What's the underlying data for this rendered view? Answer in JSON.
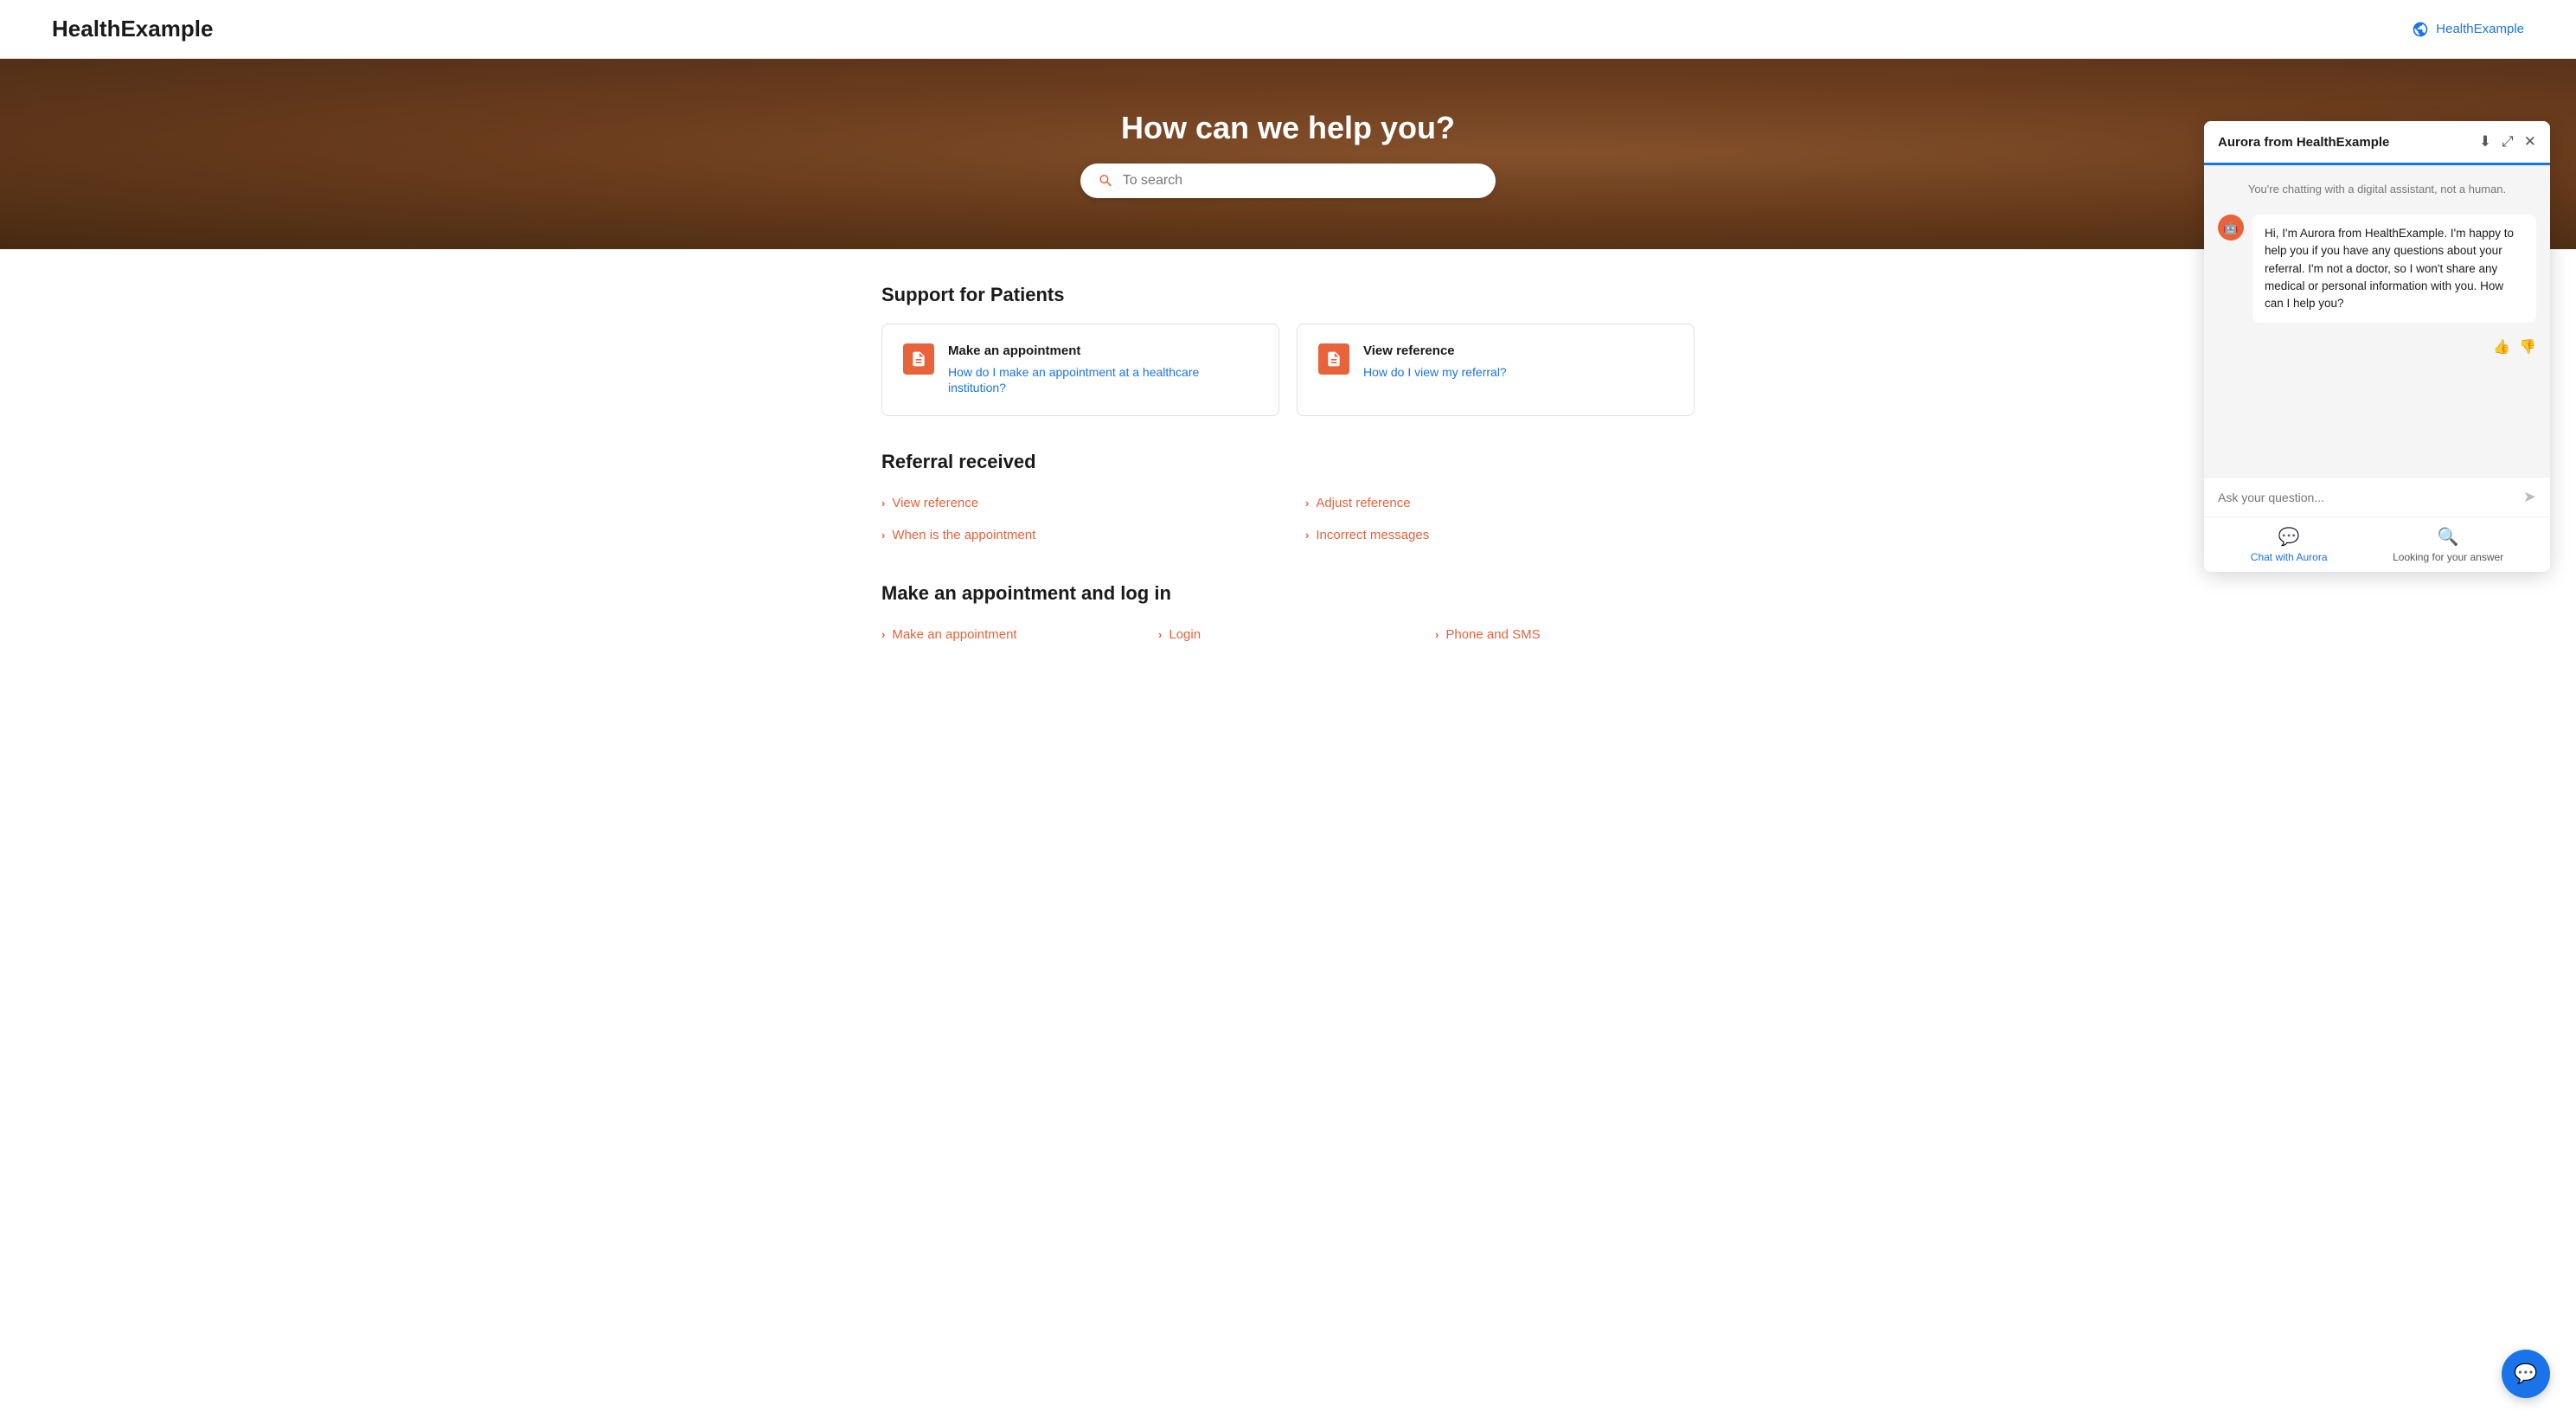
{
  "header": {
    "logo": "HealthExample",
    "nav_label": "HealthExample"
  },
  "hero": {
    "title": "How can we help you?",
    "search_placeholder": "To search"
  },
  "main": {
    "support_title": "Support for Patients",
    "cards": [
      {
        "id": "make-appointment",
        "title": "Make an appointment",
        "link_text": "How do I make an appointment at a healthcare institution?"
      },
      {
        "id": "view-reference",
        "title": "View reference",
        "link_text": "How do I view my referral?"
      }
    ],
    "referral_section": {
      "title": "Referral received",
      "links_col1": [
        {
          "label": "View reference"
        },
        {
          "label": "When is the appointment"
        }
      ],
      "links_col2": [
        {
          "label": "Adjust reference"
        },
        {
          "label": "Incorrect messages"
        }
      ]
    },
    "appointment_section": {
      "title": "Make an appointment and log in",
      "links_col1": [
        {
          "label": "Make an appointment"
        }
      ],
      "links_col2": [
        {
          "label": "Login"
        }
      ],
      "links_col3": [
        {
          "label": "Phone and SMS"
        }
      ]
    }
  },
  "chat": {
    "title": "Aurora from HealthExample",
    "notice": "You're chatting with a digital assistant, not a human.",
    "message": "Hi, I'm Aurora from HealthExample. I'm happy to help you if you have any questions about your referral. I'm not a doctor, so I won't share any medical or personal information with you. How can I help you?",
    "input_placeholder": "Ask your question...",
    "footer_chat_label": "Chat with Aurora",
    "footer_search_label": "Looking for your answer"
  },
  "icons": {
    "globe": "🌐",
    "search": "🔍",
    "download": "⬇",
    "expand": "⤢",
    "close": "✕",
    "thumbup": "👍",
    "thumbdown": "👎",
    "send": "➤",
    "chat_bubble": "💬",
    "search_footer": "🔍",
    "aurora_avatar": "🤖",
    "chevron": "›"
  },
  "colors": {
    "accent": "#e8623a",
    "blue": "#1a73e8"
  }
}
